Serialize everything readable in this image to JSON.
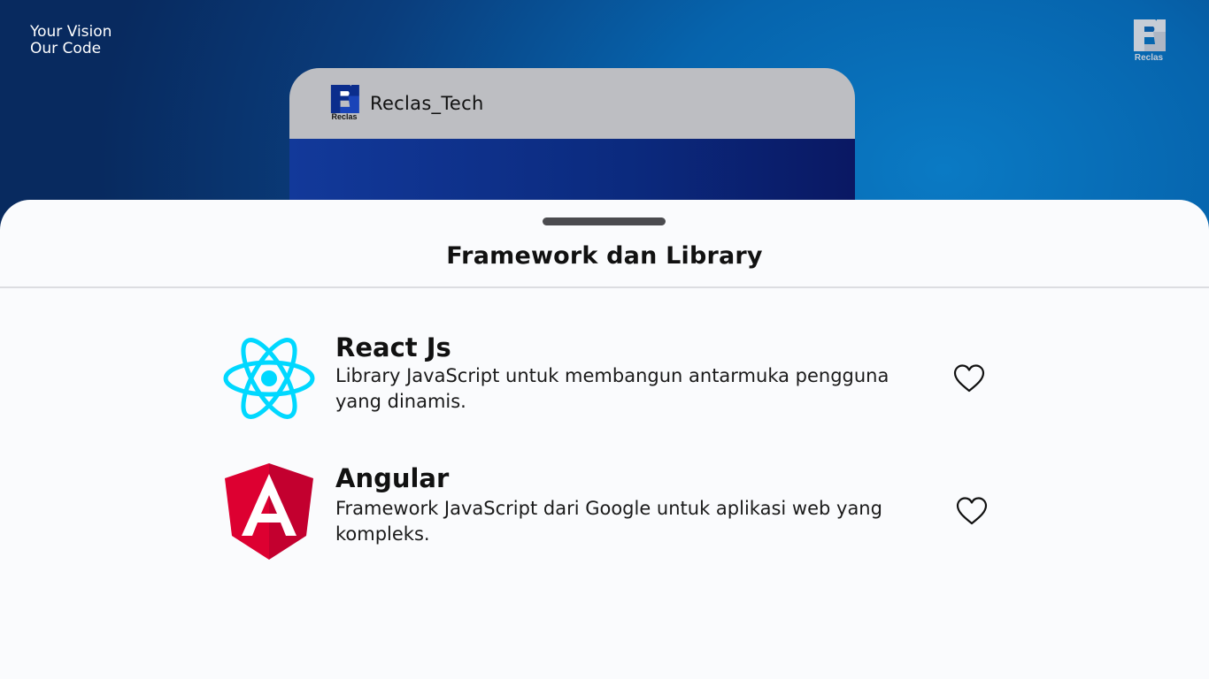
{
  "tagline": {
    "line1": "Your Vision",
    "line2": "Our Code"
  },
  "brand": {
    "corner_word": "Reclas",
    "header_word": "Reclas"
  },
  "phone_header": {
    "account_name": "Reclas_Tech"
  },
  "sheet": {
    "title": "Framework dan Library",
    "items": [
      {
        "name": "React Js",
        "description": "Library JavaScript untuk membangun antarmuka pengguna yang dinamis.",
        "icon": "react-logo-icon",
        "favorite_icon": "heart-outline-icon"
      },
      {
        "name": "Angular",
        "description": "Framework JavaScript dari Google untuk aplikasi web yang kompleks.",
        "icon": "angular-logo-icon",
        "favorite_icon": "heart-outline-icon"
      }
    ]
  },
  "colors": {
    "react": "#00d8ff",
    "angular_left": "#dd0031",
    "angular_right": "#c3002f",
    "phone_header": "#bdbec2",
    "sheet_bg": "#fafbfd"
  }
}
